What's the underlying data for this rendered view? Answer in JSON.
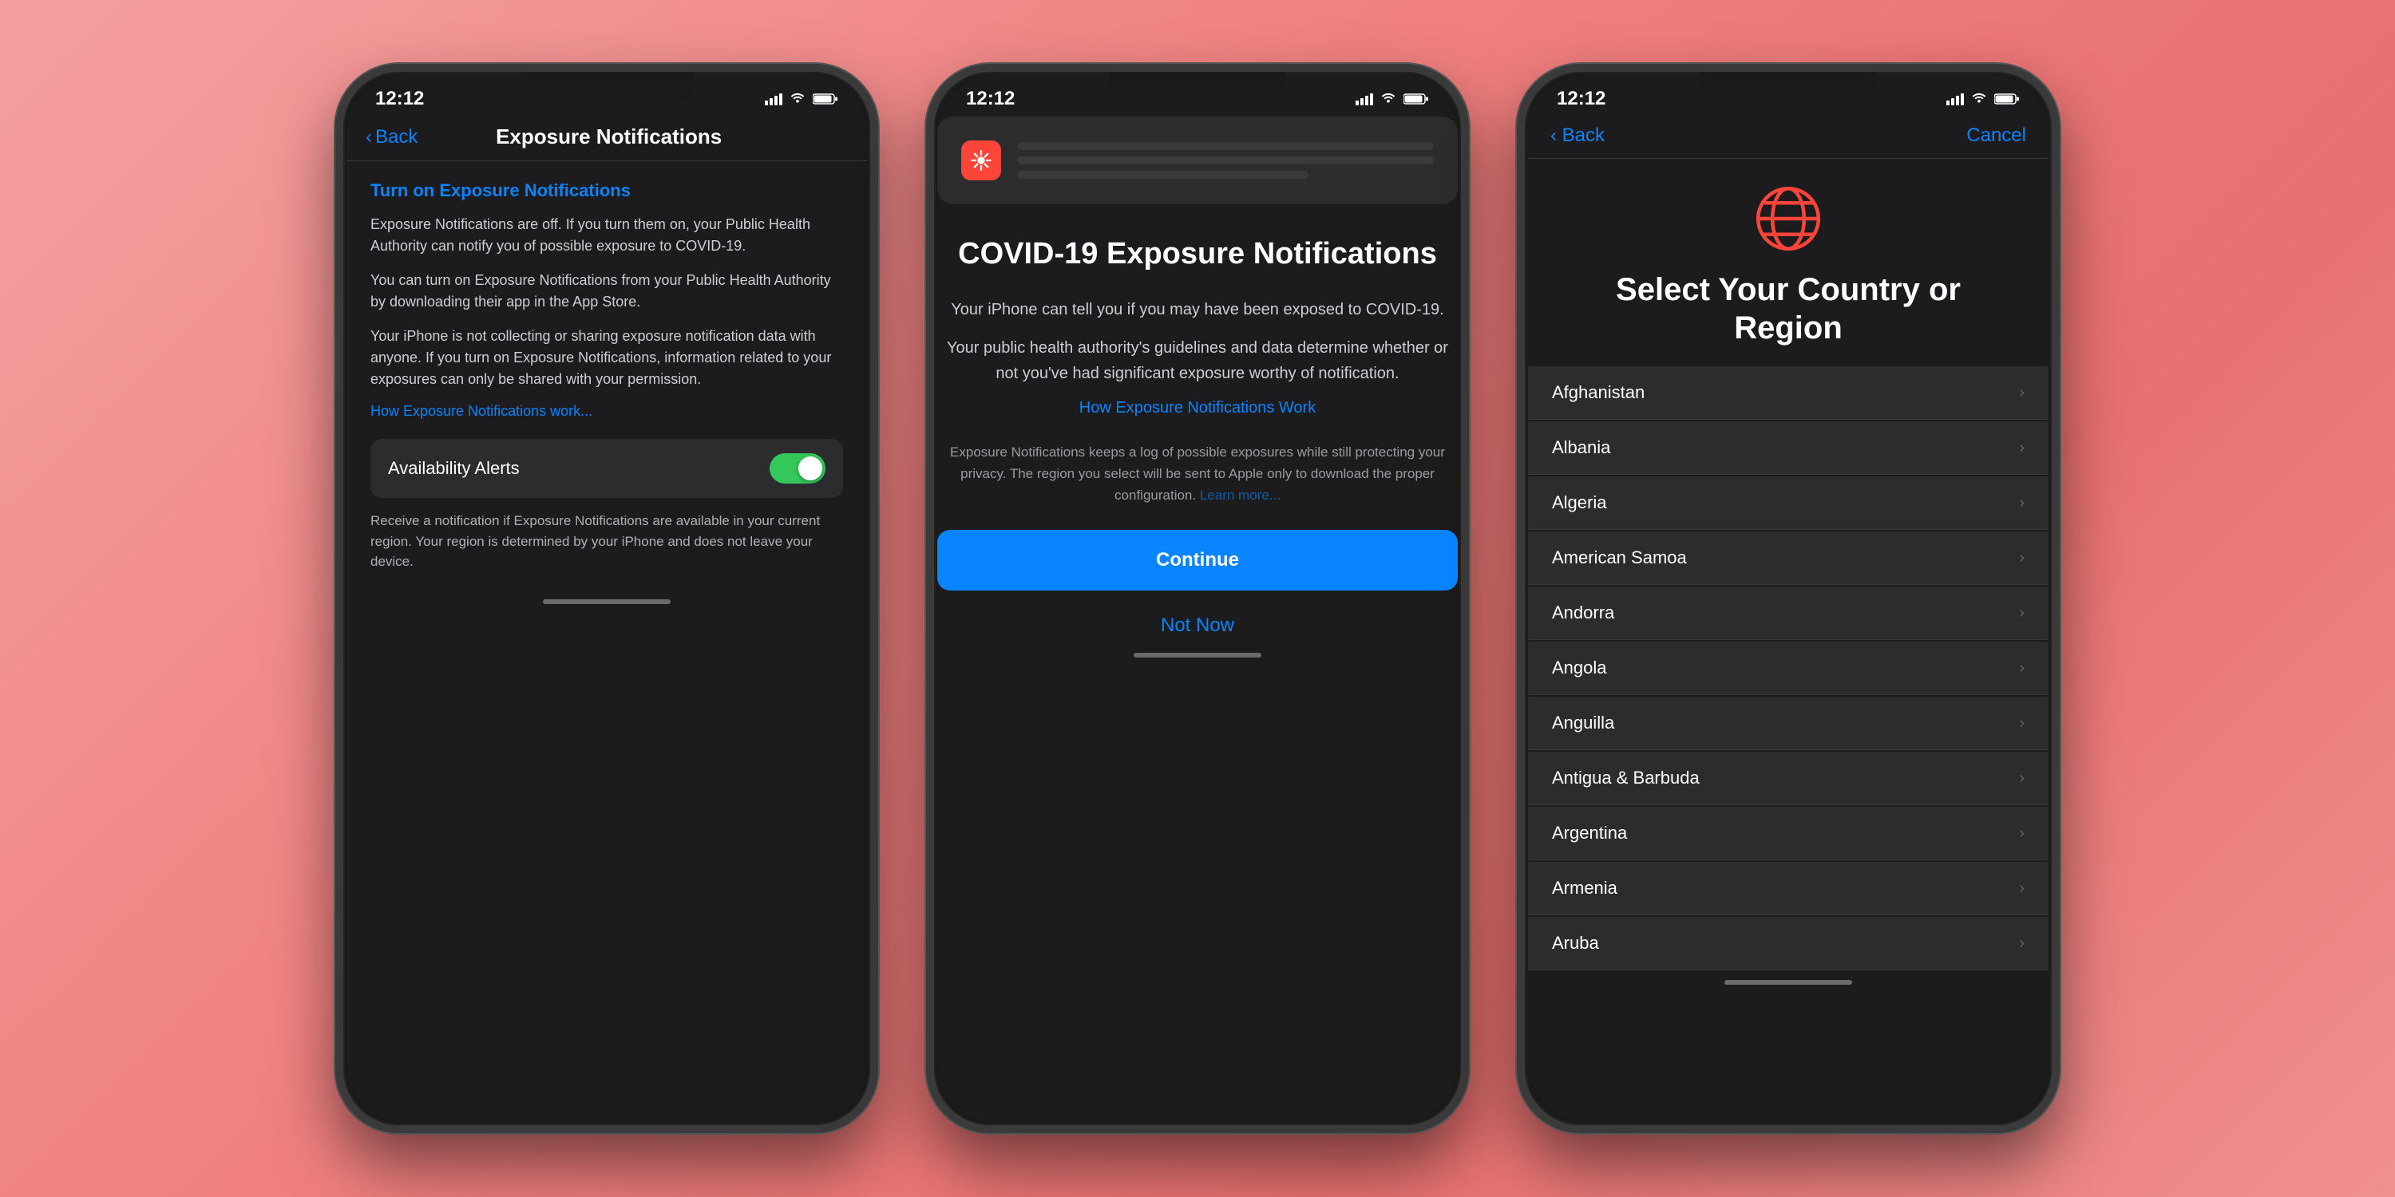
{
  "background": "#f08080",
  "phones": {
    "phone1": {
      "status_time": "12:12",
      "nav_back": "Back",
      "nav_title": "Exposure Notifications",
      "section_title": "Turn on Exposure Notifications",
      "paragraph1": "Exposure Notifications are off. If you turn them on, your Public Health Authority can notify you of possible exposure to COVID-19.",
      "paragraph2": "You can turn on Exposure Notifications from your Public Health Authority by downloading their app in the App Store.",
      "paragraph3": "Your iPhone is not collecting or sharing exposure notification data with anyone. If you turn on Exposure Notifications, information related to your exposures can only be shared with your permission.",
      "link": "How Exposure Notifications work...",
      "toggle_label": "Availability Alerts",
      "toggle_desc": "Receive a notification if Exposure Notifications are available in your current region. Your region is determined by your iPhone and does not leave your device."
    },
    "phone2": {
      "status_time": "12:12",
      "title": "COVID-19 Exposure Notifications",
      "desc1": "Your iPhone can tell you if you may have been exposed to COVID-19.",
      "desc2": "Your public health authority's guidelines and data determine whether or not you've had significant exposure worthy of notification.",
      "link": "How Exposure Notifications Work",
      "privacy_text": "Exposure Notifications keeps a log of possible exposures while still protecting your privacy. The region you select will be sent to Apple only to download the proper configuration.",
      "privacy_link": "Learn more...",
      "btn_continue": "Continue",
      "btn_not_now": "Not Now"
    },
    "phone3": {
      "status_time": "12:12",
      "nav_back": "Back",
      "nav_cancel": "Cancel",
      "title": "Select Your Country or Region",
      "countries": [
        "Afghanistan",
        "Albania",
        "Algeria",
        "American Samoa",
        "Andorra",
        "Angola",
        "Anguilla",
        "Antigua & Barbuda",
        "Argentina",
        "Armenia",
        "Aruba"
      ]
    }
  }
}
